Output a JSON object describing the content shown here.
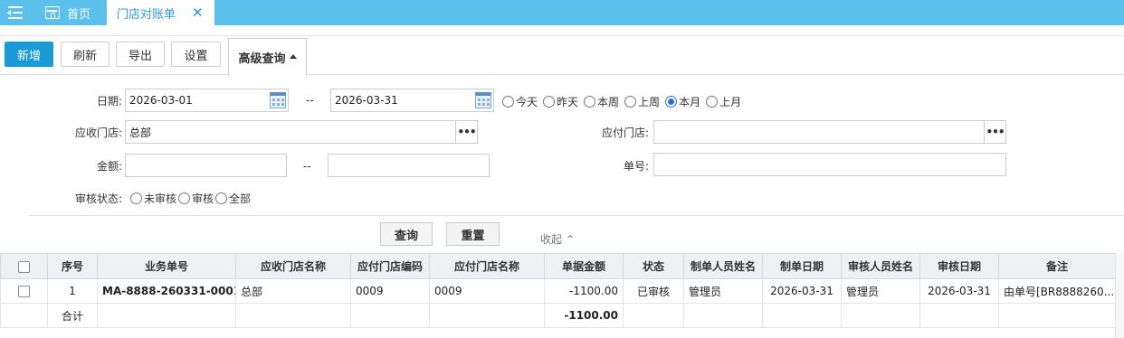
{
  "tabs": {
    "home_label": "首页",
    "active_label": "门店对账单",
    "close_glyph": "✕"
  },
  "toolbar": {
    "new_label": "新增",
    "refresh_label": "刷新",
    "export_label": "导出",
    "settings_label": "设置",
    "advanced_query_label": "高级查询"
  },
  "form": {
    "date_label": "日期:",
    "date_start": "2026-03-01",
    "date_end": "2026-03-31",
    "range_separator": "--",
    "date_quick_options": [
      {
        "label": "今天",
        "selected": false
      },
      {
        "label": "昨天",
        "selected": false
      },
      {
        "label": "本周",
        "selected": false
      },
      {
        "label": "上周",
        "selected": false
      },
      {
        "label": "本月",
        "selected": true
      },
      {
        "label": "上月",
        "selected": false
      }
    ],
    "receivable_store_label": "应收门店:",
    "receivable_store_value": "总部",
    "payable_store_label": "应付门店:",
    "payable_store_value": "",
    "amount_label": "金额:",
    "amount_min": "",
    "amount_max": "",
    "doc_no_label": "单号:",
    "doc_no_value": "",
    "audit_status_label": "审核状态:",
    "audit_options": [
      {
        "label": "未审核",
        "selected": false
      },
      {
        "label": "审核",
        "selected": false
      },
      {
        "label": "全部",
        "selected": false
      }
    ],
    "query_button": "查询",
    "reset_button": "重置",
    "collapse_label": "收起 ⌃"
  },
  "grid": {
    "columns": [
      "序号",
      "业务单号",
      "应收门店名称",
      "应付门店编码",
      "应付门店名称",
      "单据金额",
      "状态",
      "制单人员姓名",
      "制单日期",
      "审核人员姓名",
      "审核日期",
      "备注"
    ],
    "rows": [
      {
        "index": "1",
        "doc_no": "MA-8888-260331-0001",
        "receivable_store": "总部",
        "payable_store_code": "0009",
        "payable_store_name": "0009",
        "amount": "-1100.00",
        "status": "已审核",
        "creator": "管理员",
        "created_date": "2026-03-31",
        "auditor": "管理员",
        "audit_date": "2026-03-31",
        "remark": "由单号[BR8888260..."
      }
    ],
    "footer": {
      "total_label": "合计",
      "total_amount": "-1100.00"
    }
  },
  "colors": {
    "topbar": "#5bc0eb",
    "primary": "#1a9ad6",
    "link": "#1a6fbf"
  }
}
